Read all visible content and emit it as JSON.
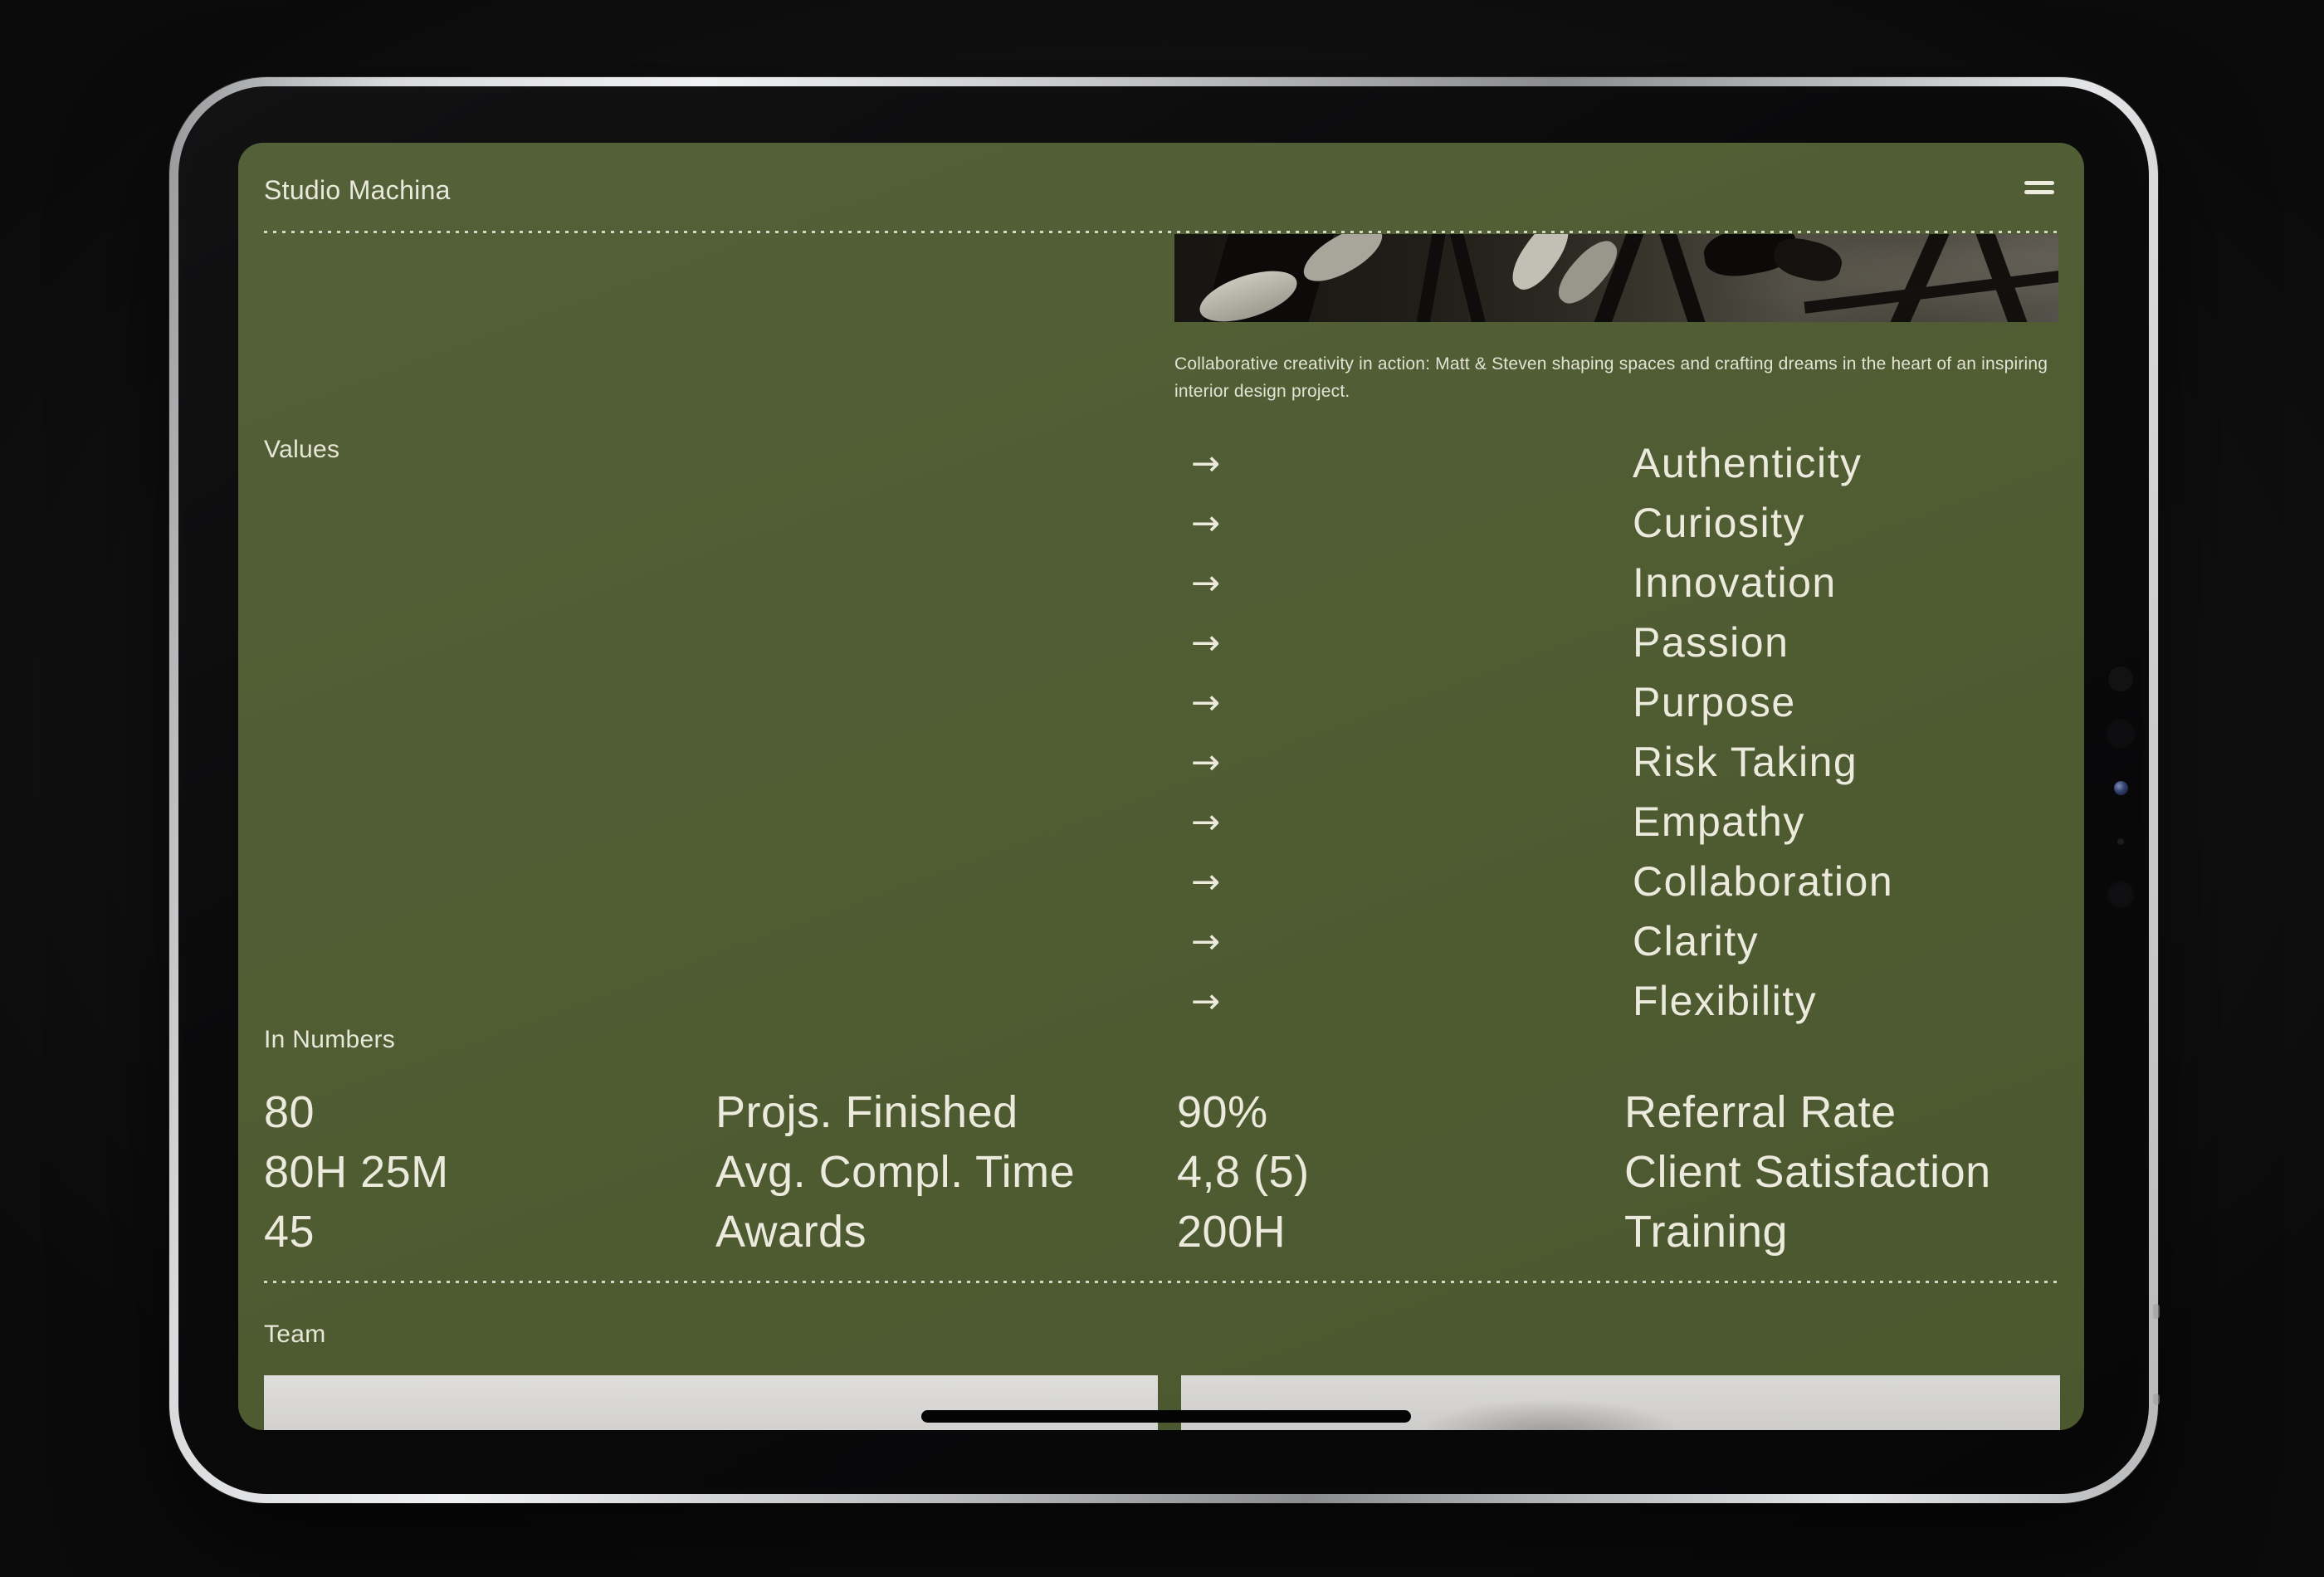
{
  "header": {
    "title": "Studio Machina"
  },
  "photo": {
    "caption": "Collaborative creativity in action: Matt & Steven shaping spaces and crafting dreams in the heart of an inspiring interior design project."
  },
  "values": {
    "label": "Values",
    "arrow": "→",
    "items": [
      "Authenticity",
      "Curiosity",
      "Innovation",
      "Passion",
      "Purpose",
      "Risk Taking",
      "Empathy",
      "Collaboration",
      "Clarity",
      "Flexibility"
    ]
  },
  "numbers": {
    "label": "In Numbers",
    "rows": [
      {
        "value": "80",
        "label": "Projs. Finished"
      },
      {
        "value": "90%",
        "label": "Referral Rate"
      },
      {
        "value": "80H 25M",
        "label": "Avg. Compl. Time"
      },
      {
        "value": "4,8 (5)",
        "label": "Client Satisfaction"
      },
      {
        "value": "45",
        "label": "Awards"
      },
      {
        "value": "200H",
        "label": "Training"
      }
    ]
  },
  "team": {
    "label": "Team"
  },
  "colors": {
    "screen_background": "#4F5B31",
    "text_cream": "#E8E7DA",
    "frame_silver": "#C9CACB",
    "home_indicator": "#040404"
  }
}
